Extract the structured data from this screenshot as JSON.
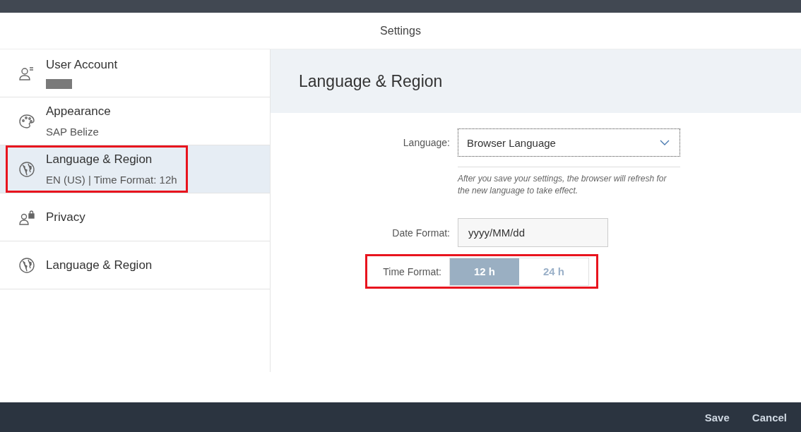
{
  "window": {
    "title": "Settings"
  },
  "sidebar": {
    "items": [
      {
        "label": "User Account",
        "redacted": true,
        "selected": false,
        "highlighted": false
      },
      {
        "label": "Appearance",
        "subtitle": "SAP Belize",
        "selected": false,
        "highlighted": false
      },
      {
        "label": "Language & Region",
        "subtitle": "EN (US) | Time Format: 12h",
        "selected": true,
        "highlighted": true
      },
      {
        "label": "Privacy",
        "selected": false,
        "highlighted": false
      },
      {
        "label": "Language & Region",
        "selected": false,
        "highlighted": false
      }
    ]
  },
  "panel": {
    "title": "Language & Region",
    "language": {
      "label": "Language:",
      "value": "Browser Language",
      "hint": "After you save your settings, the browser will refresh for the new language to take effect."
    },
    "date_format": {
      "label": "Date Format:",
      "value": "yyyy/MM/dd"
    },
    "time_format": {
      "label": "Time Format:",
      "highlighted": true,
      "options": [
        {
          "label": "12 h",
          "selected": true
        },
        {
          "label": "24 h",
          "selected": false
        }
      ]
    }
  },
  "footer": {
    "buttons": [
      "Save",
      "Cancel"
    ]
  }
}
